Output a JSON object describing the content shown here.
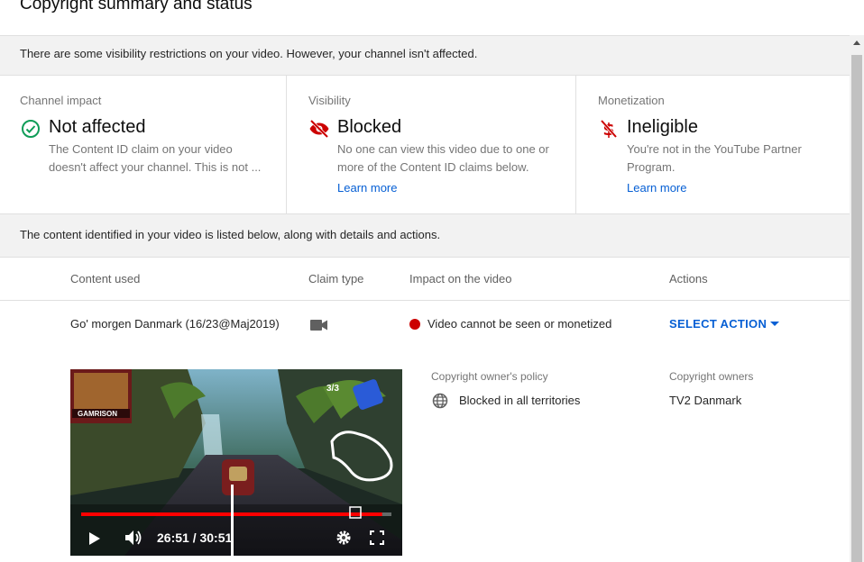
{
  "page": {
    "title": "Copyright summary and status"
  },
  "notice": {
    "text": "There are some visibility restrictions on your video. However, your channel isn't affected."
  },
  "cards": {
    "channel_impact": {
      "label": "Channel impact",
      "status": "Not affected",
      "description": "The Content ID claim on your video doesn't affect your channel. This is not ..."
    },
    "visibility": {
      "label": "Visibility",
      "status": "Blocked",
      "description": "No one can view this video due to one or more of the Content ID claims below.",
      "link": "Learn more"
    },
    "monetization": {
      "label": "Monetization",
      "status": "Ineligible",
      "description": "You're not in the YouTube Partner Program.",
      "link": "Learn more"
    }
  },
  "info": {
    "text": "The content identified in your video is listed below, along with details and actions."
  },
  "table": {
    "headers": {
      "content": "Content used",
      "claim_type": "Claim type",
      "impact": "Impact on the video",
      "actions": "Actions"
    },
    "row": {
      "content": "Go' morgen Danmark (16/23@Maj2019)",
      "claim_type_icon": "video-camera-icon",
      "impact": "Video cannot be seen or monetized",
      "action": "SELECT ACTION"
    }
  },
  "details": {
    "policy_label": "Copyright owner's policy",
    "policy_value": "Blocked in all territories",
    "owners_label": "Copyright owners",
    "owners_value": "TV2 Danmark"
  },
  "video": {
    "player_name": "GAMRISON",
    "lap_counter": "3/3",
    "time": "26:51 / 30:51",
    "progress": 0.97
  },
  "colors": {
    "accent_blue": "#065fd4",
    "ok_green": "#0f9d58",
    "error_red": "#cc0000"
  }
}
